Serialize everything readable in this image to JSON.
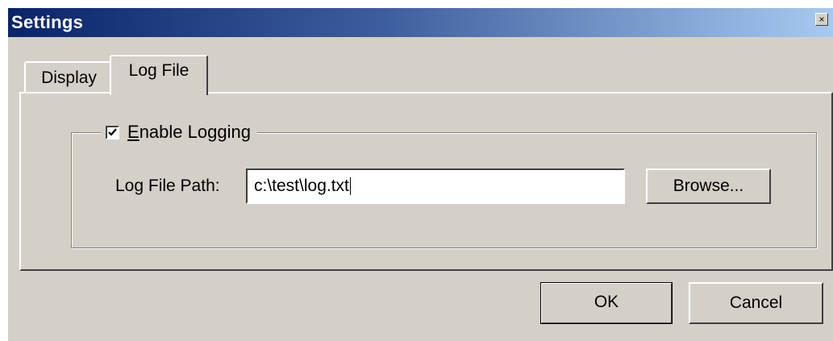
{
  "window": {
    "title": "Settings",
    "close_symbol": "×"
  },
  "tabs": [
    {
      "label": "Display",
      "selected": false
    },
    {
      "label": "Log File",
      "selected": true
    }
  ],
  "logging": {
    "enable_label_first": "E",
    "enable_label_rest": "nable Logging",
    "enabled": true,
    "path_label": "Log File Path:",
    "path_value": "c:\\test\\log.txt",
    "browse_label": "Browse..."
  },
  "footer": {
    "ok_label": "OK",
    "cancel_label": "Cancel"
  },
  "colors": {
    "dialog_face": "#d4d0c8",
    "titlebar_start": "#0a246a",
    "titlebar_end": "#a6caf0"
  }
}
